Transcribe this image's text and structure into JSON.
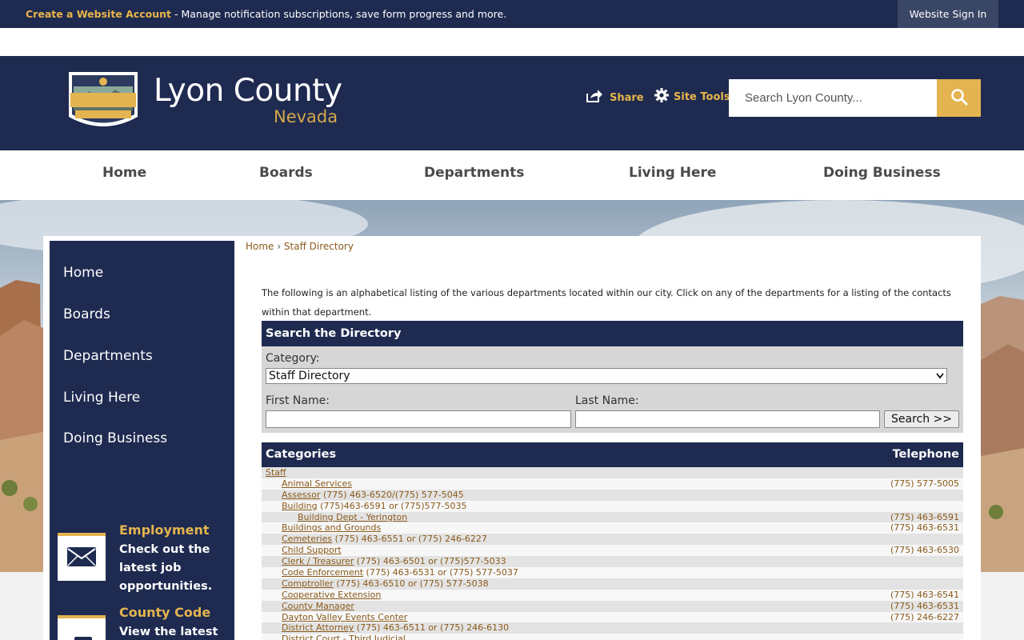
{
  "topbar": {
    "create_account": "Create a Website Account",
    "message": " - Manage notification subscriptions, save form progress and more.",
    "sign_in": "Website Sign In"
  },
  "header": {
    "site_name": "Lyon County",
    "site_sub": "Nevada",
    "share_label": "Share",
    "site_tools_label": "Site Tools",
    "search_placeholder": "Search Lyon County..."
  },
  "main_nav": [
    "Home",
    "Boards",
    "Departments",
    "Living Here",
    "Doing Business"
  ],
  "sidebar": {
    "items": [
      "Home",
      "Boards",
      "Departments",
      "Living Here",
      "Doing Business"
    ],
    "promos": [
      {
        "title": "Employment",
        "text": "Check out the latest job opportunities.",
        "icon": "envelope-icon"
      },
      {
        "title": "County Code",
        "text": "View the latest",
        "icon": "book-icon"
      }
    ]
  },
  "breadcrumb": {
    "home": "Home",
    "sep": "›",
    "current": "Staff Directory"
  },
  "intro": "The following is an alphabetical listing of the various departments located within our city. Click on any of the departments for a listing of the contacts within that department.",
  "search_directory": {
    "header": "Search the Directory",
    "category_label": "Category:",
    "category_value": "Staff Directory",
    "first_name_label": "First Name:",
    "last_name_label": "Last Name:",
    "search_button": "Search >>"
  },
  "categories": {
    "header_left": "Categories",
    "header_right": "Telephone",
    "rows": [
      {
        "name": "Staff",
        "extra": "",
        "tel": "",
        "indent": 0
      },
      {
        "name": "Animal Services",
        "extra": "",
        "tel": "(775) 577-5005",
        "indent": 1
      },
      {
        "name": "Assessor",
        "extra": " (775) 463-6520/(775) 577-5045",
        "tel": "",
        "indent": 1
      },
      {
        "name": "Building",
        "extra": " (775)463-6591 or (775)577-5035",
        "tel": "",
        "indent": 1
      },
      {
        "name": "Building Dept - Yerington",
        "extra": "",
        "tel": "(775) 463-6591",
        "indent": 2
      },
      {
        "name": "Buildings and Grounds",
        "extra": "",
        "tel": "(775) 463-6531",
        "indent": 1
      },
      {
        "name": "Cemeteries",
        "extra": " (775) 463-6551 or (775) 246-6227",
        "tel": "",
        "indent": 1
      },
      {
        "name": "Child Support",
        "extra": "",
        "tel": "(775) 463-6530",
        "indent": 1
      },
      {
        "name": "Clerk / Treasurer",
        "extra": " (775) 463-6501 or (775)577-5033",
        "tel": "",
        "indent": 1
      },
      {
        "name": "Code Enforcement",
        "extra": " (775) 463-6531 or (775) 577-5037",
        "tel": "",
        "indent": 1
      },
      {
        "name": "Comptroller",
        "extra": " (775) 463-6510 or (775) 577-5038",
        "tel": "",
        "indent": 1
      },
      {
        "name": "Cooperative Extension",
        "extra": "",
        "tel": "(775) 463-6541",
        "indent": 1
      },
      {
        "name": "County Manager",
        "extra": "",
        "tel": "(775) 463-6531",
        "indent": 1
      },
      {
        "name": "Dayton Valley Events Center",
        "extra": "",
        "tel": "(775) 246-6227",
        "indent": 1
      },
      {
        "name": "District Attorney",
        "extra": " (775) 463-6511 or (775) 246-6130",
        "tel": "",
        "indent": 1
      },
      {
        "name": "District Court - Third Judicial",
        "extra": "",
        "tel": "",
        "indent": 1
      }
    ]
  },
  "colors": {
    "navy": "#1e2a50",
    "gold": "#e3b44f",
    "link": "#8a5a1a"
  }
}
